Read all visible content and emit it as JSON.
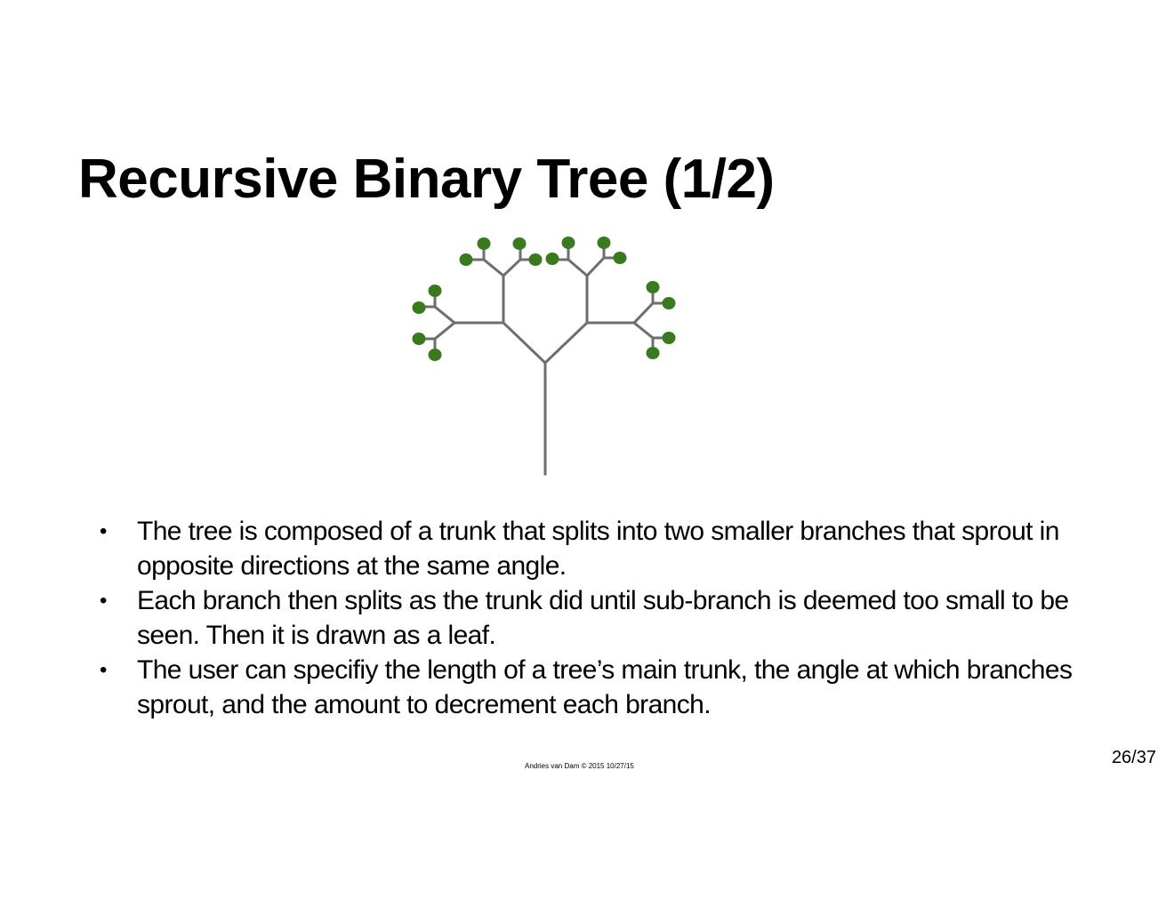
{
  "slide": {
    "title": "Recursive Binary Tree (1/2)",
    "bullets": [
      "The tree is composed of a trunk that splits into two smaller branches that sprout in opposite directions at the same angle.",
      "Each branch then splits as the trunk did until sub-branch is deemed too small to be seen. Then it is drawn as a leaf.",
      "The user can specifiy the length of a tree’s main trunk, the angle at which branches sprout, and the amount to decrement each branch."
    ],
    "bullet_glyph": "•",
    "footer": "Andries van Dam © 2015 10/27/15",
    "page_number": "26/37"
  },
  "figure": {
    "branch_color": "#6e6e6e",
    "leaf_color": "#3a7a1f",
    "depth": 4,
    "leaf_count": 16
  }
}
